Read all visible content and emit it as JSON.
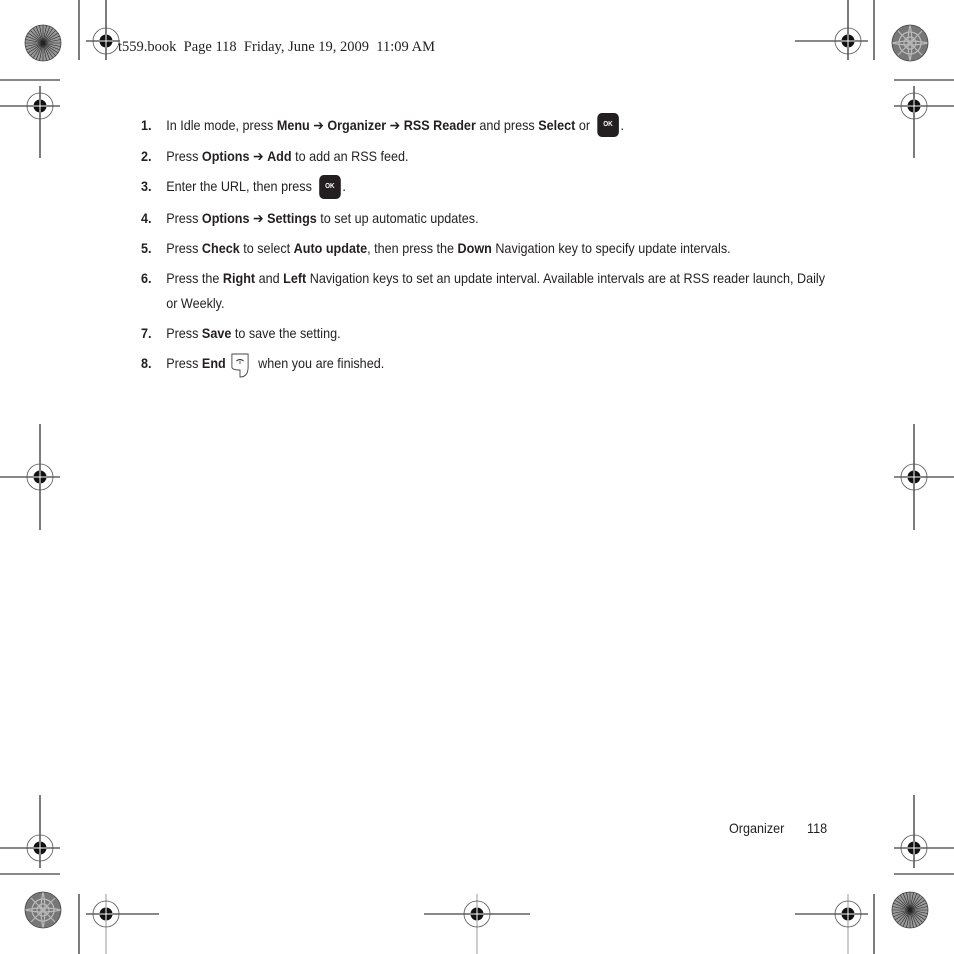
{
  "header": {
    "slug": "t559.book  Page 118  Friday, June 19, 2009  11:09 AM"
  },
  "steps": [
    {
      "num": "1.",
      "parts": [
        {
          "t": "In Idle mode, press "
        },
        {
          "t": "Menu",
          "b": true
        },
        {
          "t": " ➔ "
        },
        {
          "t": "Organizer",
          "b": true
        },
        {
          "t": " ➔ "
        },
        {
          "t": "RSS Reader",
          "b": true
        },
        {
          "t": " and press  "
        },
        {
          "t": "Select",
          "b": true
        },
        {
          "t": " or "
        },
        {
          "key": "ok"
        },
        {
          "t": "."
        }
      ]
    },
    {
      "num": "2.",
      "parts": [
        {
          "t": "Press "
        },
        {
          "t": "Options",
          "b": true
        },
        {
          "t": " ➔ "
        },
        {
          "t": "Add",
          "b": true
        },
        {
          "t": " to add an RSS feed."
        }
      ]
    },
    {
      "num": "3.",
      "parts": [
        {
          "t": "Enter the URL, then press "
        },
        {
          "key": "ok"
        },
        {
          "t": "."
        }
      ]
    },
    {
      "num": "4.",
      "parts": [
        {
          "t": "Press "
        },
        {
          "t": "Options",
          "b": true
        },
        {
          "t": " ➔ "
        },
        {
          "t": "Settings",
          "b": true
        },
        {
          "t": " to set up automatic updates."
        }
      ]
    },
    {
      "num": "5.",
      "parts": [
        {
          "t": "Press "
        },
        {
          "t": "Check",
          "b": true
        },
        {
          "t": " to select "
        },
        {
          "t": "Auto update",
          "b": true
        },
        {
          "t": ", then press the "
        },
        {
          "t": "Down",
          "b": true
        },
        {
          "t": " Navigation key to specify update intervals."
        }
      ]
    },
    {
      "num": "6.",
      "parts": [
        {
          "t": "Press the "
        },
        {
          "t": "Right",
          "b": true
        },
        {
          "t": " and "
        },
        {
          "t": "Left",
          "b": true
        },
        {
          "t": " Navigation keys to set an update interval. Available intervals are at RSS reader launch, Daily or Weekly."
        }
      ]
    },
    {
      "num": "7.",
      "parts": [
        {
          "t": "Press "
        },
        {
          "t": "Save",
          "b": true
        },
        {
          "t": " to save the setting."
        }
      ]
    },
    {
      "num": "8.",
      "parts": [
        {
          "t": "Press "
        },
        {
          "t": "End",
          "b": true
        },
        {
          "key": "end"
        },
        {
          "t": "when you are finished."
        }
      ]
    }
  ],
  "keys": {
    "ok_label": "OK"
  },
  "footer": {
    "section": "Organizer",
    "page": "118"
  }
}
